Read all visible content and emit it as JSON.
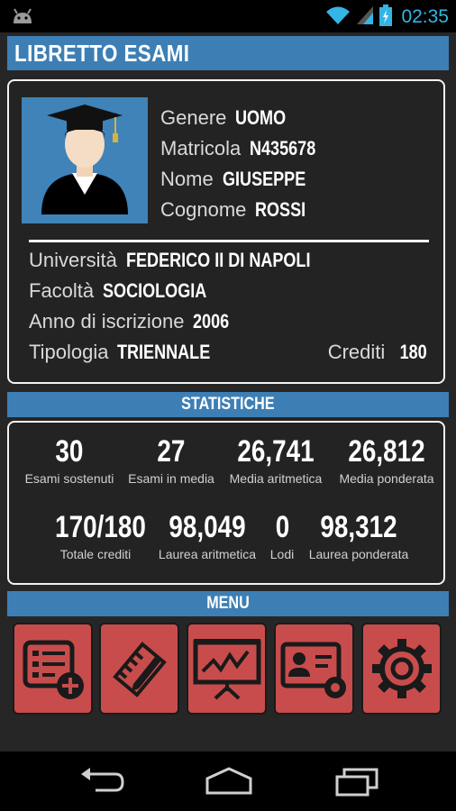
{
  "status_bar": {
    "time": "02:35"
  },
  "app": {
    "title": "LIBRETTO ESAMI"
  },
  "profile": {
    "genere_label": "Genere",
    "genere": "UOMO",
    "matricola_label": "Matricola",
    "matricola": "N435678",
    "nome_label": "Nome",
    "nome": "GIUSEPPE",
    "cognome_label": "Cognome",
    "cognome": "ROSSI",
    "universita_label": "Università",
    "universita": "FEDERICO II DI NAPOLI",
    "facolta_label": "Facoltà",
    "facolta": "SOCIOLOGIA",
    "anno_label": "Anno di iscrizione",
    "anno": "2006",
    "tipologia_label": "Tipologia",
    "tipologia": "TRIENNALE",
    "crediti_label": "Crediti",
    "crediti": "180"
  },
  "stats": {
    "section_title": "STATISTICHE",
    "items": [
      {
        "value": "30",
        "label": "Esami sostenuti"
      },
      {
        "value": "27",
        "label": "Esami in media"
      },
      {
        "value": "26,741",
        "label": "Media aritmetica"
      },
      {
        "value": "26,812",
        "label": "Media ponderata"
      },
      {
        "value": "170/180",
        "label": "Totale crediti"
      },
      {
        "value": "98,049",
        "label": "Laurea aritmetica"
      },
      {
        "value": "0",
        "label": "Lodi"
      },
      {
        "value": "98,312",
        "label": "Laurea ponderata"
      }
    ]
  },
  "menu": {
    "section_title": "MENU",
    "buttons": [
      {
        "icon": "add-exam-list-icon"
      },
      {
        "icon": "notes-pencil-icon"
      },
      {
        "icon": "chart-presentation-icon"
      },
      {
        "icon": "profile-settings-icon"
      },
      {
        "icon": "gear-icon"
      }
    ]
  },
  "colors": {
    "accent": "#3d7fb5",
    "menu_button": "#c94c4c",
    "clock": "#33b5e5",
    "background": "#262626"
  }
}
